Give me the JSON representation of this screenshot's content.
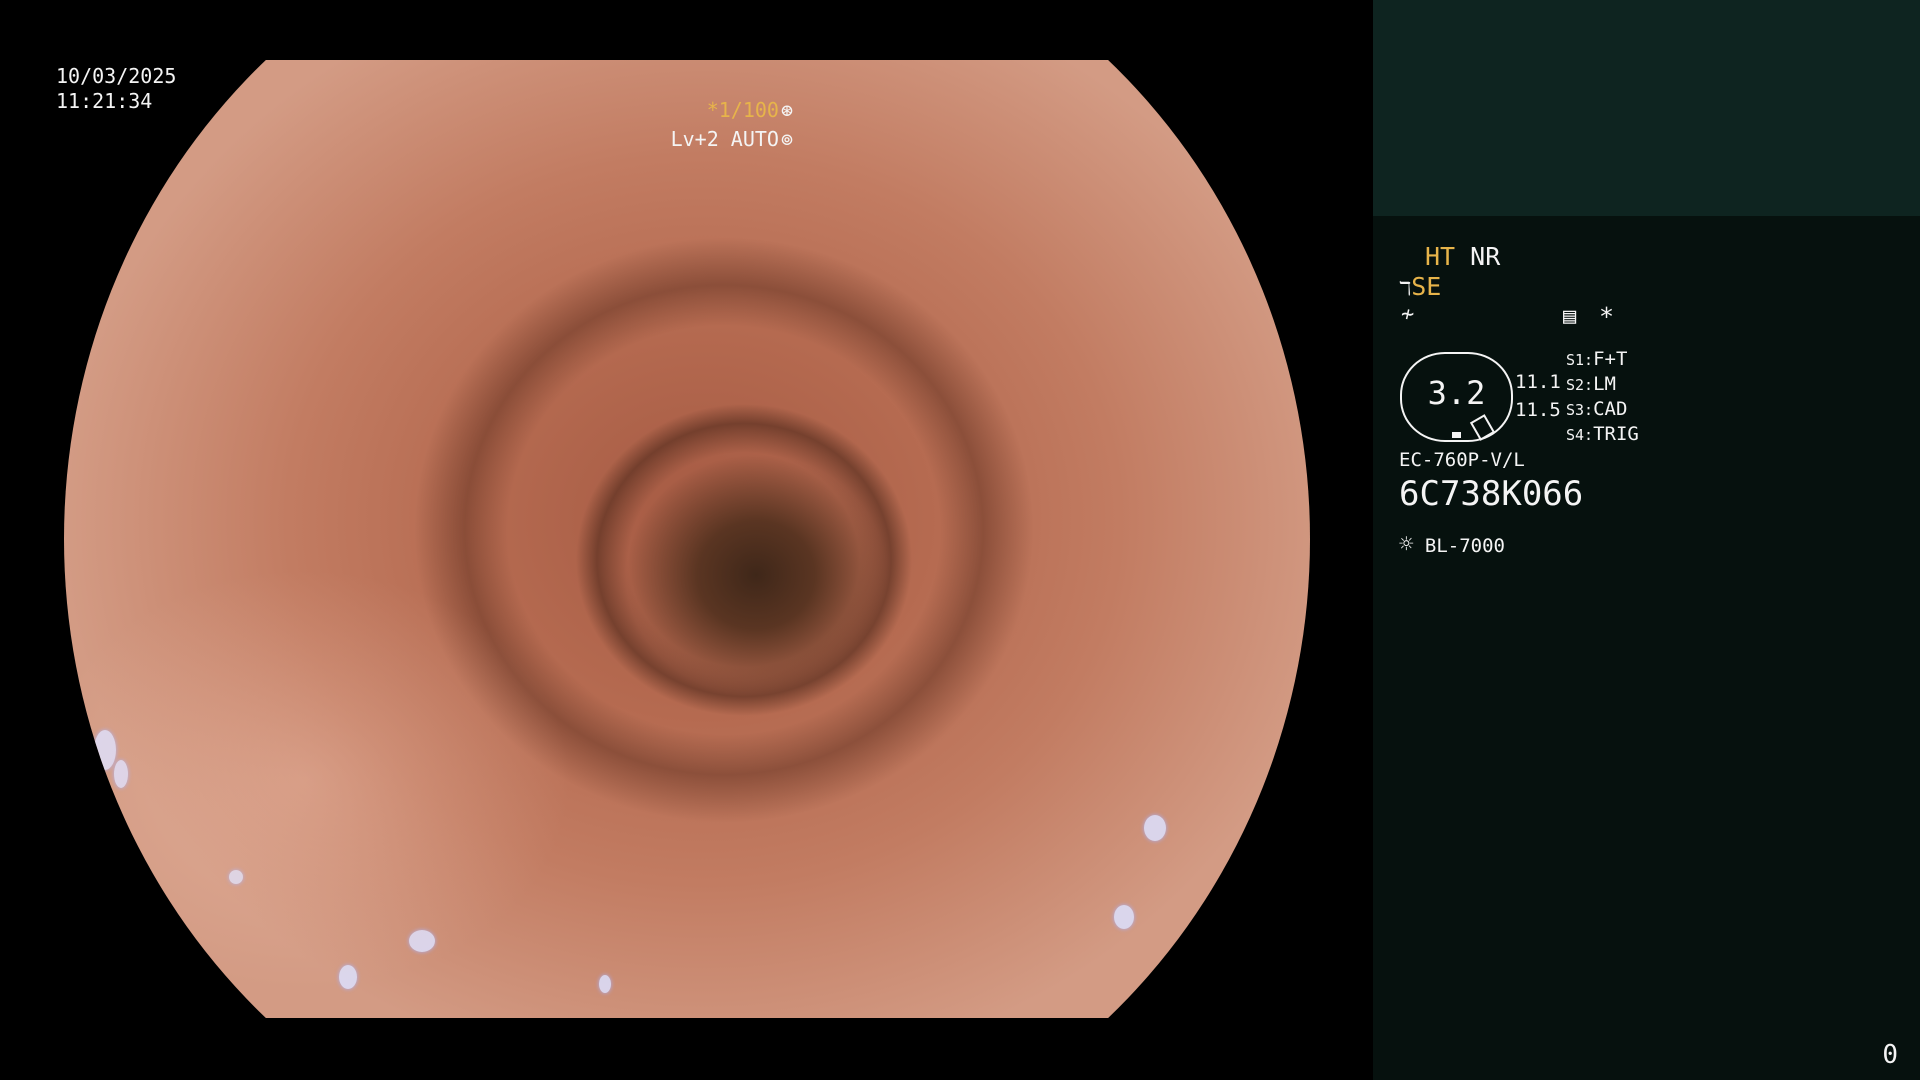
{
  "overlay": {
    "date": "10/03/2025",
    "time": "11:21:34",
    "shutter": "*1/100",
    "shutter_icon": "shutter-icon",
    "level": "Lv+2 AUTO",
    "iris_icon": "iris-icon"
  },
  "panel": {
    "ht": "HT",
    "nr": "NR",
    "se": "SE",
    "freeze_icon": "freeze-icon",
    "settings_icon": "settings-icon",
    "asterisk": "*",
    "zoom_value": "3.2",
    "readout_1": "11.1",
    "readout_2": "11.5",
    "switches": [
      {
        "label": "S1:",
        "value": "F+T"
      },
      {
        "label": "S2:",
        "value": "LM"
      },
      {
        "label": "S3:",
        "value": "CAD"
      },
      {
        "label": "S4:",
        "value": "TRIG"
      }
    ],
    "scope_model": "EC-760P-V/L",
    "scope_serial": "6C738K066",
    "light_icon": "light-source-icon",
    "light_source": "BL-7000",
    "counter": "0"
  },
  "colors": {
    "amber": "#e7b44a",
    "panel_bg": "#06110e",
    "panel_top": "#0e2420"
  }
}
